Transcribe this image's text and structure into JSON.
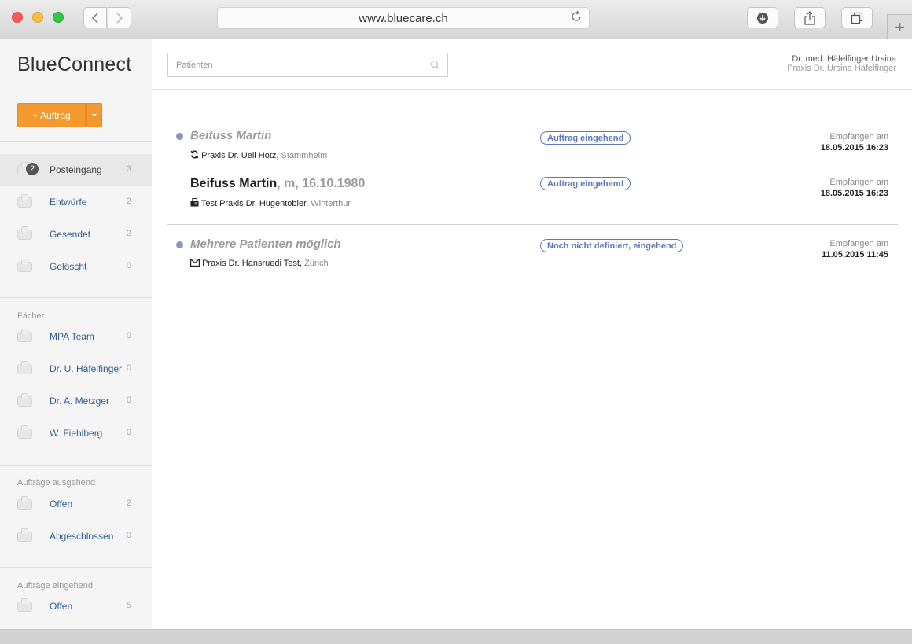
{
  "browser": {
    "url": "www.bluecare.ch"
  },
  "app": {
    "logo": "BlueConnect",
    "new_order_label": "+ Auftrag"
  },
  "search": {
    "placeholder": "Patienten"
  },
  "user": {
    "name": "Dr. med. Häfelfinger Ursina",
    "practice": "Praxis Dr. Ursina Häfelfinger"
  },
  "sidebar": {
    "mailboxes": [
      {
        "label": "Posteingang",
        "count": "3",
        "badge": "2"
      },
      {
        "label": "Entwürfe",
        "count": "2"
      },
      {
        "label": "Gesendet",
        "count": "2"
      },
      {
        "label": "Gelöscht",
        "count": "0"
      }
    ],
    "faecher": {
      "title": "Fächer",
      "items": [
        {
          "label": "MPA Team",
          "count": "0"
        },
        {
          "label": "Dr. U. Häfelfinger",
          "count": "0"
        },
        {
          "label": "Dr. A. Metzger",
          "count": "0"
        },
        {
          "label": "W. Fiehlberg",
          "count": "0"
        }
      ]
    },
    "outgoing": {
      "title": "Aufträge ausgehend",
      "items": [
        {
          "label": "Offen",
          "count": "2"
        },
        {
          "label": "Abgeschlossen",
          "count": "0"
        }
      ]
    },
    "incoming": {
      "title": "Aufträge eingehend",
      "items": [
        {
          "label": "Offen",
          "count": "5"
        }
      ]
    }
  },
  "messages": [
    {
      "title": "Beifuss Martin",
      "meta": "",
      "sender_icon": "sync-icon",
      "sender": "Praxis Dr. Ueli Hotz,",
      "location": "Stammheim",
      "status": "Auftrag eingehend",
      "received_label": "Empfangen am",
      "received": "18.05.2015 16:23",
      "unread": true
    },
    {
      "title": "Beifuss Martin",
      "meta": ", m, 16.10.1980",
      "sender_icon": "fax-icon",
      "sender": "Test Praxis Dr. Hugentobler,",
      "location": "Winterthur",
      "status": "Auftrag eingehend",
      "received_label": "Empfangen am",
      "received": "18.05.2015 16:23",
      "unread": false
    },
    {
      "title": "Mehrere Patienten möglich",
      "meta": "",
      "sender_icon": "envelope-icon",
      "sender": "Praxis Dr. Hansruedi Test,",
      "location": "Zürich",
      "status": "Noch nicht definiert, eingehend",
      "received_label": "Empfangen am",
      "received": "11.05.2015 11:45",
      "unread": true
    }
  ]
}
